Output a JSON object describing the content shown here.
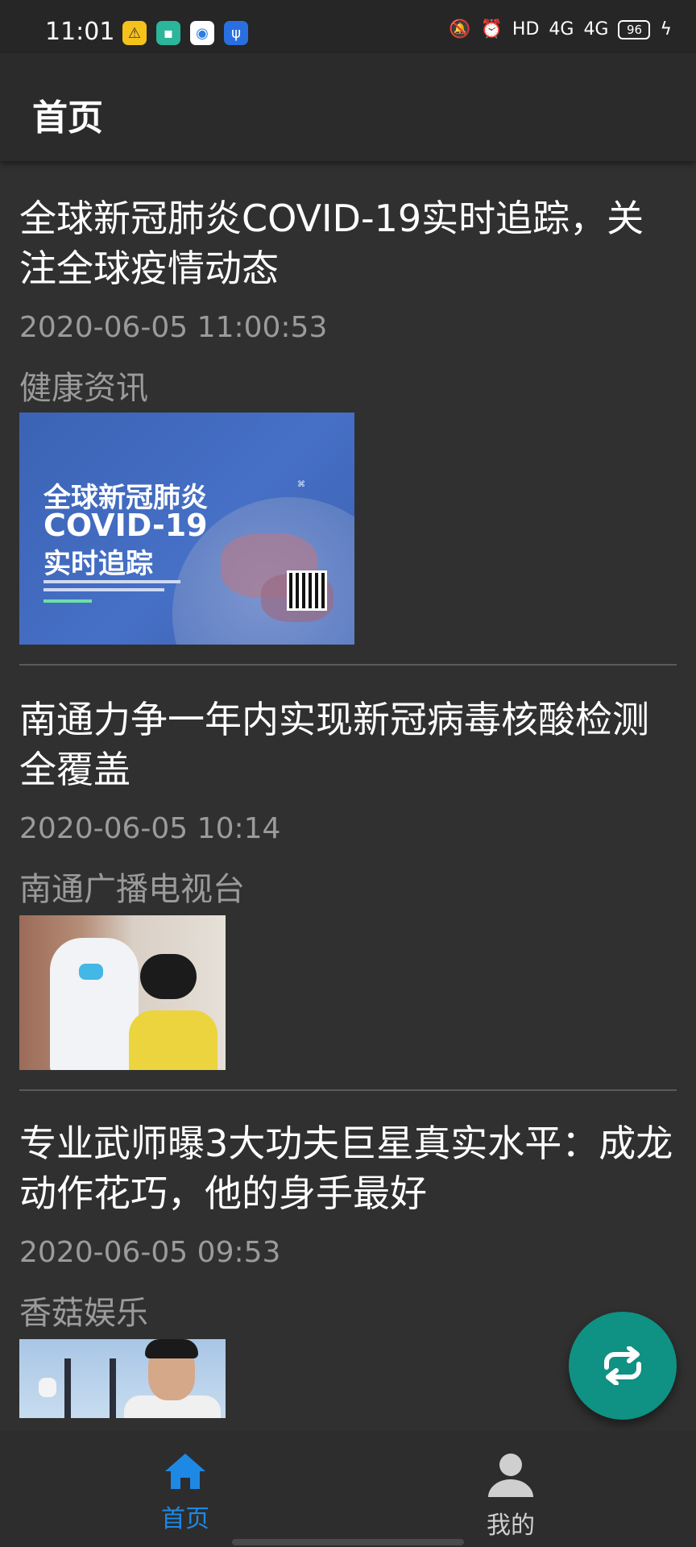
{
  "status_bar": {
    "time": "11:01",
    "network_label": "HD",
    "signal1": "4G",
    "signal2": "4G",
    "battery": "96"
  },
  "app_bar": {
    "title": "首页"
  },
  "news": [
    {
      "title": "全球新冠肺炎COVID-19实时追踪，关注全球疫情动态",
      "time": "2020-06-05 11:00:53",
      "source": "健康资讯",
      "image_text": [
        "全球新冠肺炎",
        "COVID-19",
        "实时追踪"
      ]
    },
    {
      "title": "南通力争一年内实现新冠病毒核酸检测全覆盖",
      "time": "2020-06-05 10:14",
      "source": "南通广播电视台"
    },
    {
      "title": "专业武师曝3大功夫巨星真实水平：成龙动作花巧，他的身手最好",
      "time": "2020-06-05 09:53",
      "source": "香菇娱乐"
    }
  ],
  "fab": {
    "icon": "refresh-icon"
  },
  "bottom_nav": {
    "items": [
      {
        "label": "首页",
        "icon": "home-icon",
        "active": true,
        "color": "#1e88e5"
      },
      {
        "label": "我的",
        "icon": "person-icon",
        "active": false,
        "color": "#cfcfcf"
      }
    ]
  },
  "colors": {
    "background": "#303030",
    "app_bar": "#2b2b2b",
    "fab": "#0f9183",
    "accent": "#1e88e5",
    "secondary_text": "#9b9b9b"
  }
}
